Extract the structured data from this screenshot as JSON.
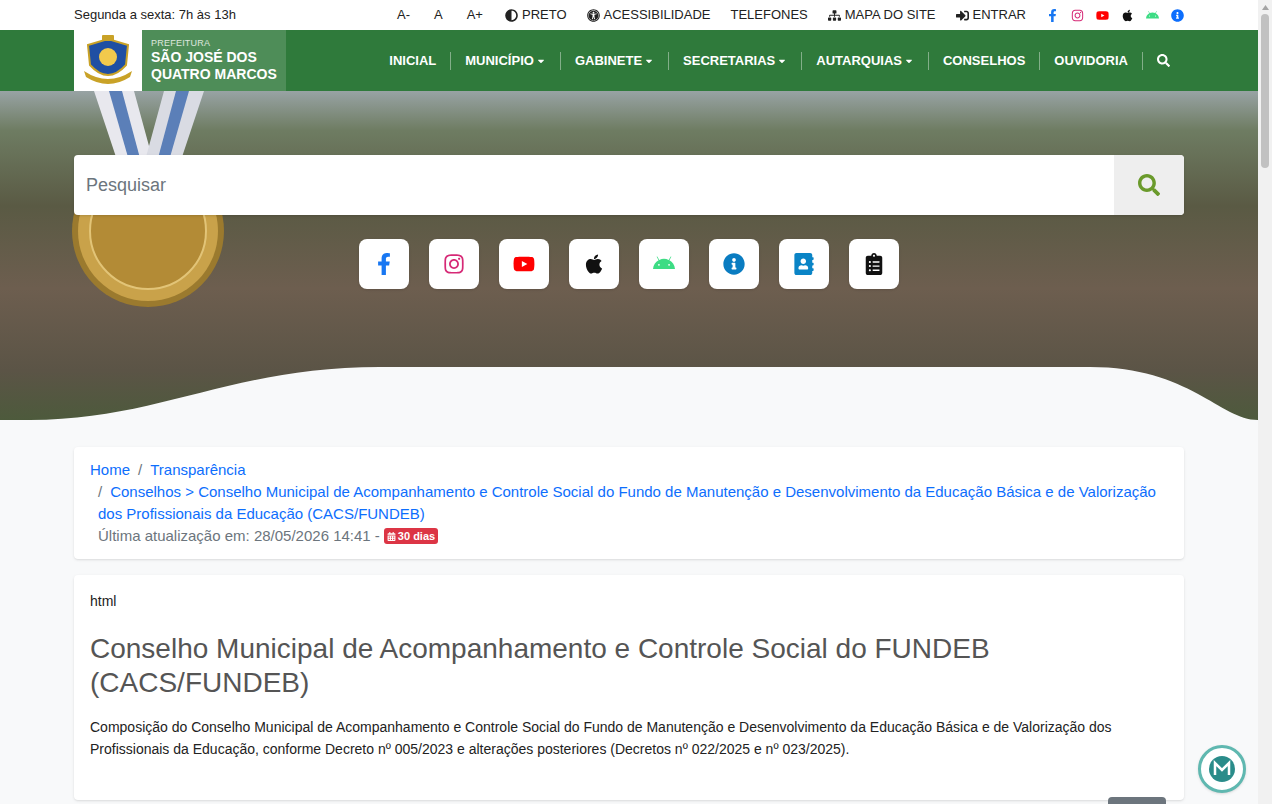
{
  "top_bar": {
    "hours": "Segunda a sexta: 7h às 13h",
    "font_buttons": [
      "A-",
      "A",
      "A+"
    ],
    "links": [
      {
        "label": "PRETO",
        "kind": "contrast"
      },
      {
        "label": "ACESSIBILIDADE",
        "kind": "accessibility"
      },
      {
        "label": "TELEFONES",
        "kind": "none"
      },
      {
        "label": "MAPA DO SITE",
        "kind": "sitemap"
      },
      {
        "label": "ENTRAR",
        "kind": "login"
      }
    ],
    "social": [
      {
        "kind": "facebook",
        "color": "#1877f2"
      },
      {
        "kind": "instagram",
        "color": "#d62976"
      },
      {
        "kind": "youtube",
        "color": "#ff0000"
      },
      {
        "kind": "apple",
        "color": "#111111"
      },
      {
        "kind": "android",
        "color": "#3ddc84"
      },
      {
        "kind": "info",
        "color": "#0d6efd"
      }
    ]
  },
  "nav": {
    "logo": {
      "small": "PREFEITURA",
      "name_lines": [
        "SÃO JOSÉ DOS",
        "QUATRO MARCOS"
      ]
    },
    "items": [
      {
        "label": "INICIAL",
        "dropdown": false
      },
      {
        "label": "MUNICÍPIO",
        "dropdown": true
      },
      {
        "label": "GABINETE",
        "dropdown": true
      },
      {
        "label": "SECRETARIAS",
        "dropdown": true
      },
      {
        "label": "AUTARQUIAS",
        "dropdown": true
      },
      {
        "label": "CONSELHOS",
        "dropdown": false
      },
      {
        "label": "OUVIDORIA",
        "dropdown": false
      }
    ]
  },
  "search": {
    "placeholder": "Pesquisar"
  },
  "hero_buttons": [
    {
      "kind": "facebook",
      "color": "#1877f2"
    },
    {
      "kind": "instagram",
      "color": "#d62976"
    },
    {
      "kind": "youtube",
      "color": "#ff0000"
    },
    {
      "kind": "apple",
      "color": "#111111"
    },
    {
      "kind": "android",
      "color": "#3ddc84"
    },
    {
      "kind": "info",
      "color": "#0a7cc1"
    },
    {
      "kind": "contacts",
      "color": "#0a84c6"
    },
    {
      "kind": "clipboard",
      "color": "#111111"
    }
  ],
  "breadcrumb": {
    "separator": "/",
    "items": [
      {
        "label": "Home"
      },
      {
        "label": "Transparência"
      },
      {
        "label": "Conselhos > Conselho Municipal de Acompanhamento e Controle Social do Fundo de Manutenção e Desenvolvimento da Educação Básica e de Valorização dos Profissionais da Educação (CACS/FUNDEB)"
      }
    ],
    "updated": "Última atualização em: 28/05/2026 14:41 -",
    "badge": "30 dias"
  },
  "content": {
    "label": "html",
    "title": "Conselho Municipal de Acompanhamento e Controle Social do FUNDEB (CACS/FUNDEB)",
    "text": "Composição do Conselho Municipal de Acompanhamento e Controle Social do Fundo de Manutenção e Desenvolvimento da Educação Básica e de Valorização dos Profissionais da Educação, conforme Decreto nº 005/2023 e alterações posteriores (Decretos nº 022/2025 e nº 023/2025)."
  }
}
